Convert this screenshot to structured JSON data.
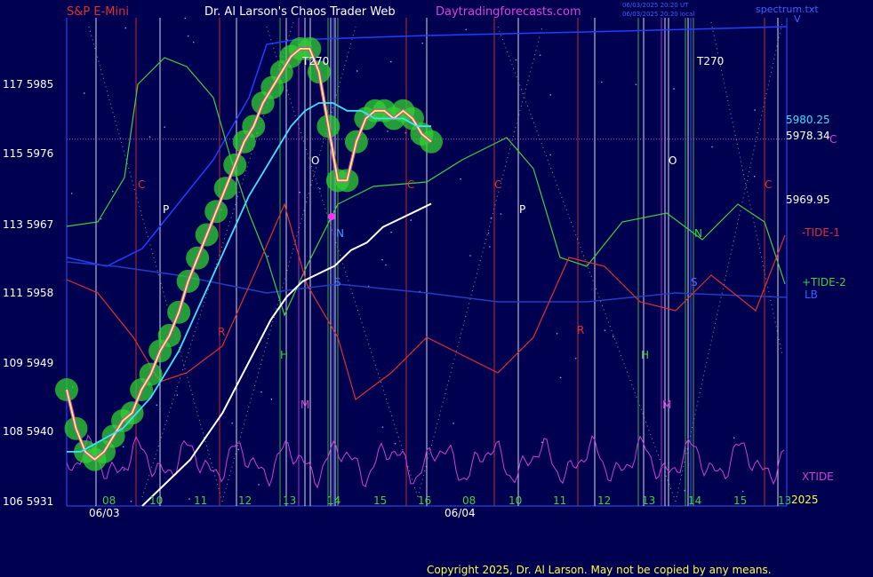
{
  "header": {
    "symbol": "S&P E-Mini",
    "site_title": "Dr. Al Larson's Chaos Trader Web",
    "site_url": "Daytradingforecasts.com",
    "stamp_1": "06/03/2025 20:20 UT",
    "stamp_2": "06/03/2025 20:20 local",
    "spectrum_file": "spectrum.txt",
    "corner_mark": "V"
  },
  "footer": {
    "copyright": "Copyright 2025, Dr. Al Larson. May not be copied by any means."
  },
  "chart_data": {
    "type": "line",
    "x_axis": {
      "hour_labels": [
        "08",
        "10",
        "11",
        "12",
        "13",
        "14",
        "15",
        "16",
        "08",
        "10",
        "11",
        "12",
        "13",
        "14",
        "15",
        "13"
      ],
      "date_labels": [
        "06/03",
        "06/04"
      ],
      "year_label": "2025"
    },
    "y_axis": {
      "labels": [
        "117 5985",
        "115 5976",
        "113 5967",
        "111 5958",
        "109 5949",
        "108 5940",
        "106 5931"
      ],
      "range": [
        5931,
        5994
      ]
    },
    "price_labels": [
      "5980.25",
      "5978.34",
      "5969.95"
    ],
    "price_label_suffix": "C",
    "legend": [
      {
        "label": "-TIDE-1",
        "color": "#e03030"
      },
      {
        "label": "+TIDE-2",
        "color": "#40d040"
      },
      {
        "label": "LB",
        "color": "#3060ff"
      },
      {
        "label": "XTIDE",
        "color": "#d040d0"
      }
    ],
    "line_markers": [
      {
        "label": "C",
        "color": "#e03030"
      },
      {
        "label": "P",
        "color": "#ffffff"
      },
      {
        "label": "R",
        "color": "#e03030"
      },
      {
        "label": "H",
        "color": "#40d040"
      },
      {
        "label": "M",
        "color": "#d040d0"
      },
      {
        "label": "O",
        "color": "#ffffff"
      },
      {
        "label": "N",
        "color": "#40a0ff"
      },
      {
        "label": "S",
        "color": "#6060ff"
      },
      {
        "label": "C",
        "color": "#e03030"
      },
      {
        "label": "C",
        "color": "#e03030"
      },
      {
        "label": "P",
        "color": "#ffffff"
      },
      {
        "label": "R",
        "color": "#e03030"
      },
      {
        "label": "H",
        "color": "#40d040"
      },
      {
        "label": "M",
        "color": "#d040d0"
      },
      {
        "label": "O",
        "color": "#ffffff"
      },
      {
        "label": "N",
        "color": "#40d040"
      },
      {
        "label": "S",
        "color": "#6060ff"
      },
      {
        "label": "C",
        "color": "#e03030"
      },
      {
        "label": "T270",
        "color": "#ffffff"
      },
      {
        "label": "T270",
        "color": "#ffffff"
      }
    ],
    "series": [
      {
        "color": "#ffff40",
        "values": [
          5946,
          5941,
          5938,
          5937,
          5938,
          5940,
          5942,
          5943,
          5946,
          5948,
          5951,
          5953,
          5956,
          5960,
          5963,
          5966,
          5969,
          5972,
          5975,
          5978,
          5980,
          5983,
          5985,
          5987,
          5989,
          5990,
          5990,
          5987,
          5980,
          5973,
          5973,
          5978,
          5981,
          5982,
          5982,
          5981,
          5982,
          5981,
          5979,
          5978
        ]
      },
      {
        "color": "#40e0ff",
        "values": [
          5938,
          5938,
          5939,
          5940,
          5941,
          5943,
          5945,
          5948,
          5951,
          5955,
          5959,
          5963,
          5967,
          5971,
          5974,
          5977,
          5980,
          5982,
          5983,
          5983,
          5982,
          5982,
          5981,
          5981,
          5981,
          5980,
          5980
        ]
      },
      {
        "color": "#ffffff",
        "values": [
          5931,
          5933,
          5935,
          5937,
          5940,
          5943,
          5947,
          5951,
          5955,
          5958,
          5960,
          5961,
          5962,
          5964,
          5965,
          5967,
          5968,
          5969,
          5970
        ]
      }
    ]
  }
}
